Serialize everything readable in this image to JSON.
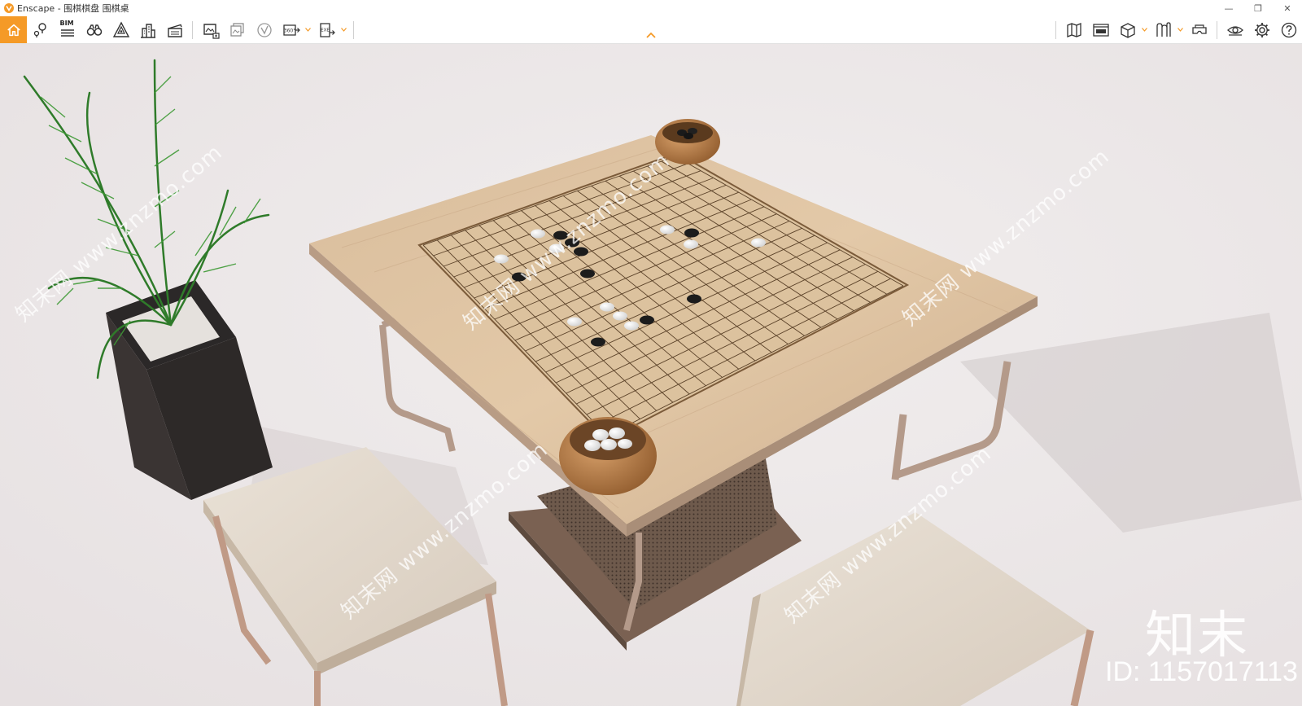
{
  "window": {
    "title": "Enscape - 围棋棋盘 围棋桌",
    "controls": {
      "minimize": "—",
      "restore": "❐",
      "close": "✕"
    }
  },
  "toolbar": {
    "bim_label": "BIM",
    "pano_label": "360°",
    "exe_label": "EXE",
    "active_tool": "home-icon",
    "accent_color": "#f59a27",
    "left_tools": [
      "home-icon",
      "map-pin-icon",
      "bim-list-icon",
      "binoculars-icon",
      "section-view-icon",
      "buildings-icon",
      "clapperboard-icon",
      "screenshot-icon",
      "batch-render-icon",
      "video-icon",
      "panorama-360-icon",
      "export-exe-icon"
    ],
    "right_tools": [
      "map-icon",
      "render-window-icon",
      "cube-icon",
      "asset-library-icon",
      "vr-headset-icon",
      "visual-settings-eye-icon",
      "gear-icon",
      "help-icon"
    ]
  },
  "viewport": {
    "watermark_text": "知末网 www.znzmo.com",
    "brand_logo": "知末",
    "brand_id": "ID: 1157017113"
  }
}
